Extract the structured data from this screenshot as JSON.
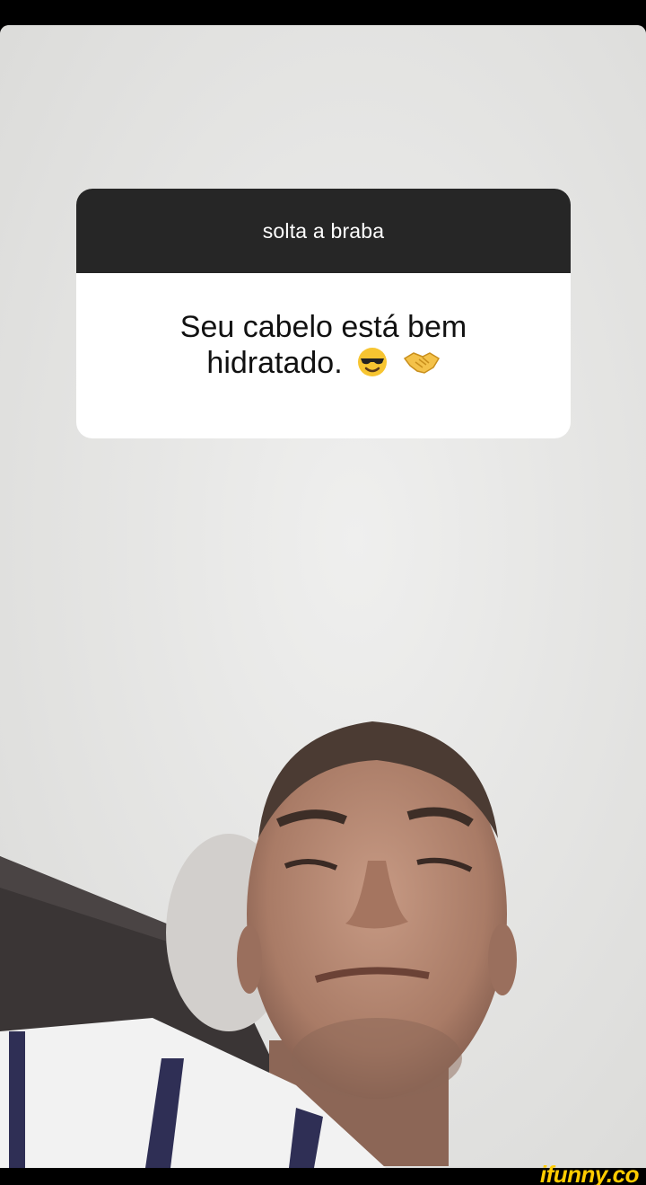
{
  "story": {
    "question_prompt": "solta a braba",
    "answer_text": "Seu cabelo está bem hidratado.",
    "answer_line1": "Seu cabelo está bem",
    "answer_line2": "hidratado.",
    "emojis": [
      "smiling-face-with-sunglasses-icon",
      "handshake-icon"
    ]
  },
  "watermark": {
    "text": "ifunny.co"
  },
  "colors": {
    "header_bg": "#262626",
    "card_bg": "#ffffff",
    "watermark": "#ffcc00"
  }
}
